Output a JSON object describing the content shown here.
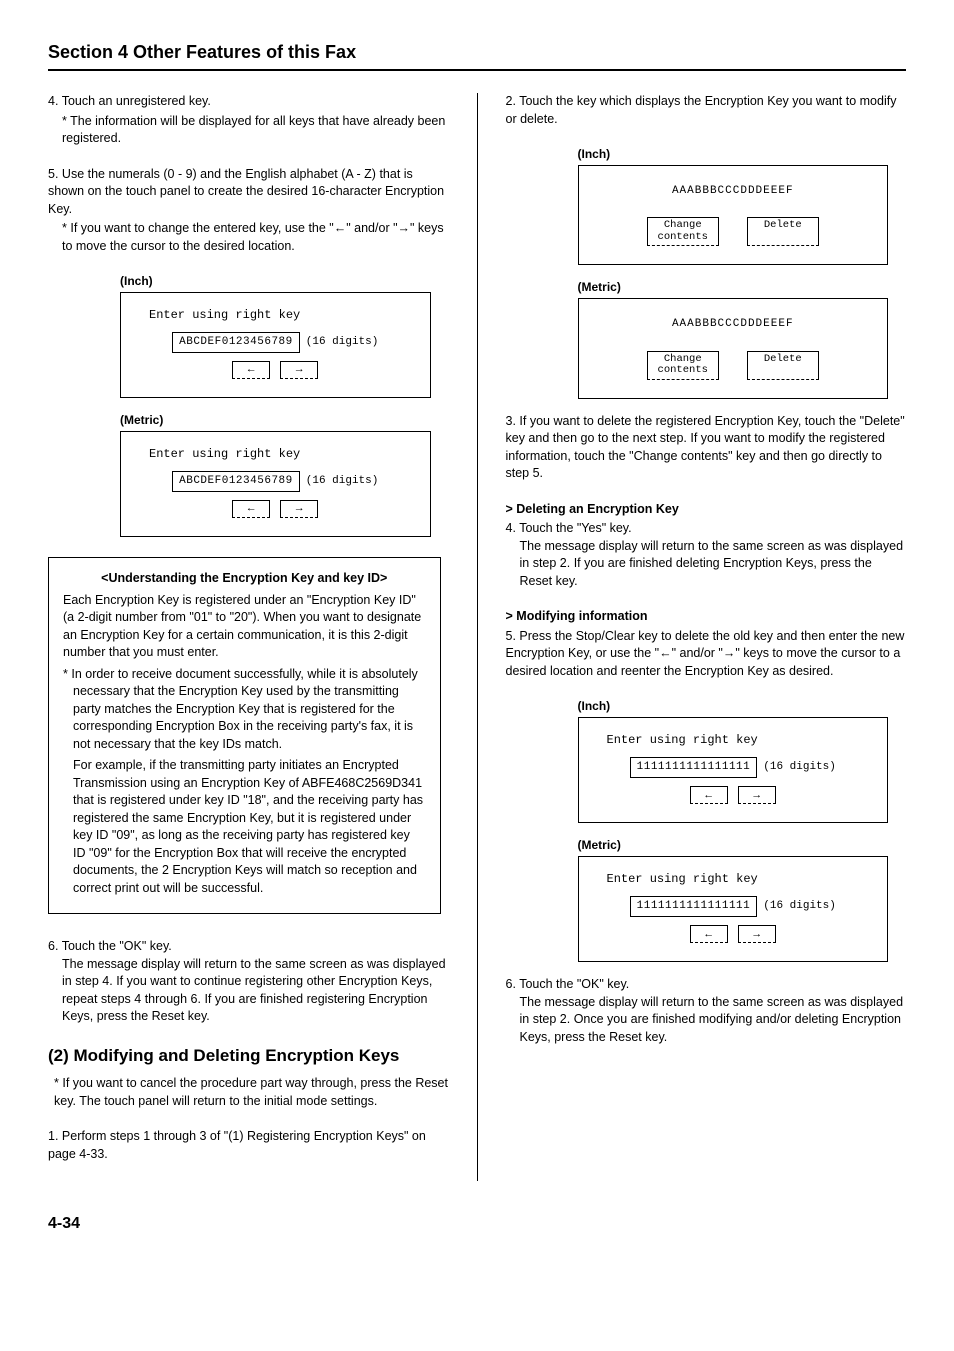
{
  "section_title": "Section 4 Other Features of this Fax",
  "page_number": "4-34",
  "left": {
    "step4": {
      "num": "4.",
      "text": "Touch an unregistered key.",
      "note": "The information will be displayed for all keys that have already been registered."
    },
    "step5": {
      "num": "5.",
      "text": "Use the numerals (0 - 9) and the English alphabet (A - Z) that is shown on the touch panel to create the desired 16-character Encryption Key.",
      "note": "If you want to change the entered key, use the \"←\" and/or \"→\" keys to move the cursor to the desired location."
    },
    "panel_inch_label": "(Inch)",
    "panel_metric_label": "(Metric)",
    "panel_prompt": "Enter using right key",
    "panel_value": "ABCDEF0123456789",
    "panel_digits": "(16 digits)",
    "arrow_left": "←",
    "arrow_right": "→",
    "callout": {
      "title": "<Understanding the Encryption Key and key ID>",
      "p1": "Each Encryption Key is registered under an \"Encryption Key ID\" (a 2-digit number from \"01\" to \"20\"). When you want to designate an Encryption Key for a certain communication, it is this 2-digit number that you must enter.",
      "p2": "In order to receive document successfully, while it is absolutely necessary that the Encryption Key used by the transmitting party matches the Encryption Key that is registered for the corresponding Encryption Box in the receiving party's fax, it is not necessary that the key IDs match.",
      "p3": "For example, if the transmitting party initiates an Encrypted Transmission using an Encryption Key of ABFE468C2569D341 that is registered under key ID \"18\", and the receiving party has registered the same Encryption Key, but it is registered under key ID \"09\", as long as the receiving party has registered key ID \"09\" for the Encryption Box that will receive the encrypted documents, the 2 Encryption Keys will match so reception and correct print out will be successful."
    },
    "step6": {
      "num": "6.",
      "text": "Touch the \"OK\" key.",
      "cont": "The message display will return to the same screen as was displayed in step 4. If you want to continue registering other Encryption Keys, repeat steps 4 through 6. If you are finished registering Encryption Keys, press the Reset key."
    },
    "h2": "(2) Modifying and Deleting Encryption Keys",
    "h2_note": "If you want to cancel the procedure part way through, press the Reset key. The touch panel will return to the initial mode settings.",
    "step1": {
      "num": "1.",
      "text": "Perform steps 1 through 3 of \"(1) Registering Encryption Keys\" on page 4-33."
    }
  },
  "right": {
    "step2": {
      "num": "2.",
      "text": "Touch the key which displays the Encryption Key you want to modify or delete."
    },
    "panel_inch_label": "(Inch)",
    "panel_metric_label": "(Metric)",
    "panel_keytext": "AAABBBCCCDDDEEEF",
    "btn_change": "Change\ncontents",
    "btn_delete": "Delete",
    "step3": {
      "num": "3.",
      "text": "If you want to delete the registered Encryption Key, touch the \"Delete\" key and then go to the next step. If you want to modify the registered information, touch the \"Change contents\" key and then go directly to step 5."
    },
    "del_head": "Deleting an Encryption Key",
    "step4": {
      "num": "4.",
      "text": "Touch the \"Yes\" key.",
      "cont": "The message display will return to the same screen as was displayed in step 2. If you are finished deleting Encryption Keys, press the Reset key."
    },
    "mod_head": "Modifying information",
    "step5": {
      "num": "5.",
      "text": "Press the Stop/Clear key to delete the old key and then enter the new Encryption Key, or use the \"←\" and/or \"→\" keys to move the cursor to a desired location and reenter the Encryption Key as desired."
    },
    "panel2_prompt": "Enter using right key",
    "panel2_value": "1111111111111111",
    "panel2_digits": "(16 digits)",
    "step6": {
      "num": "6.",
      "text": "Touch the \"OK\" key.",
      "cont": "The message display will return to the same screen as was displayed in step 2. Once you are finished modifying and/or deleting Encryption Keys, press the Reset key."
    }
  }
}
